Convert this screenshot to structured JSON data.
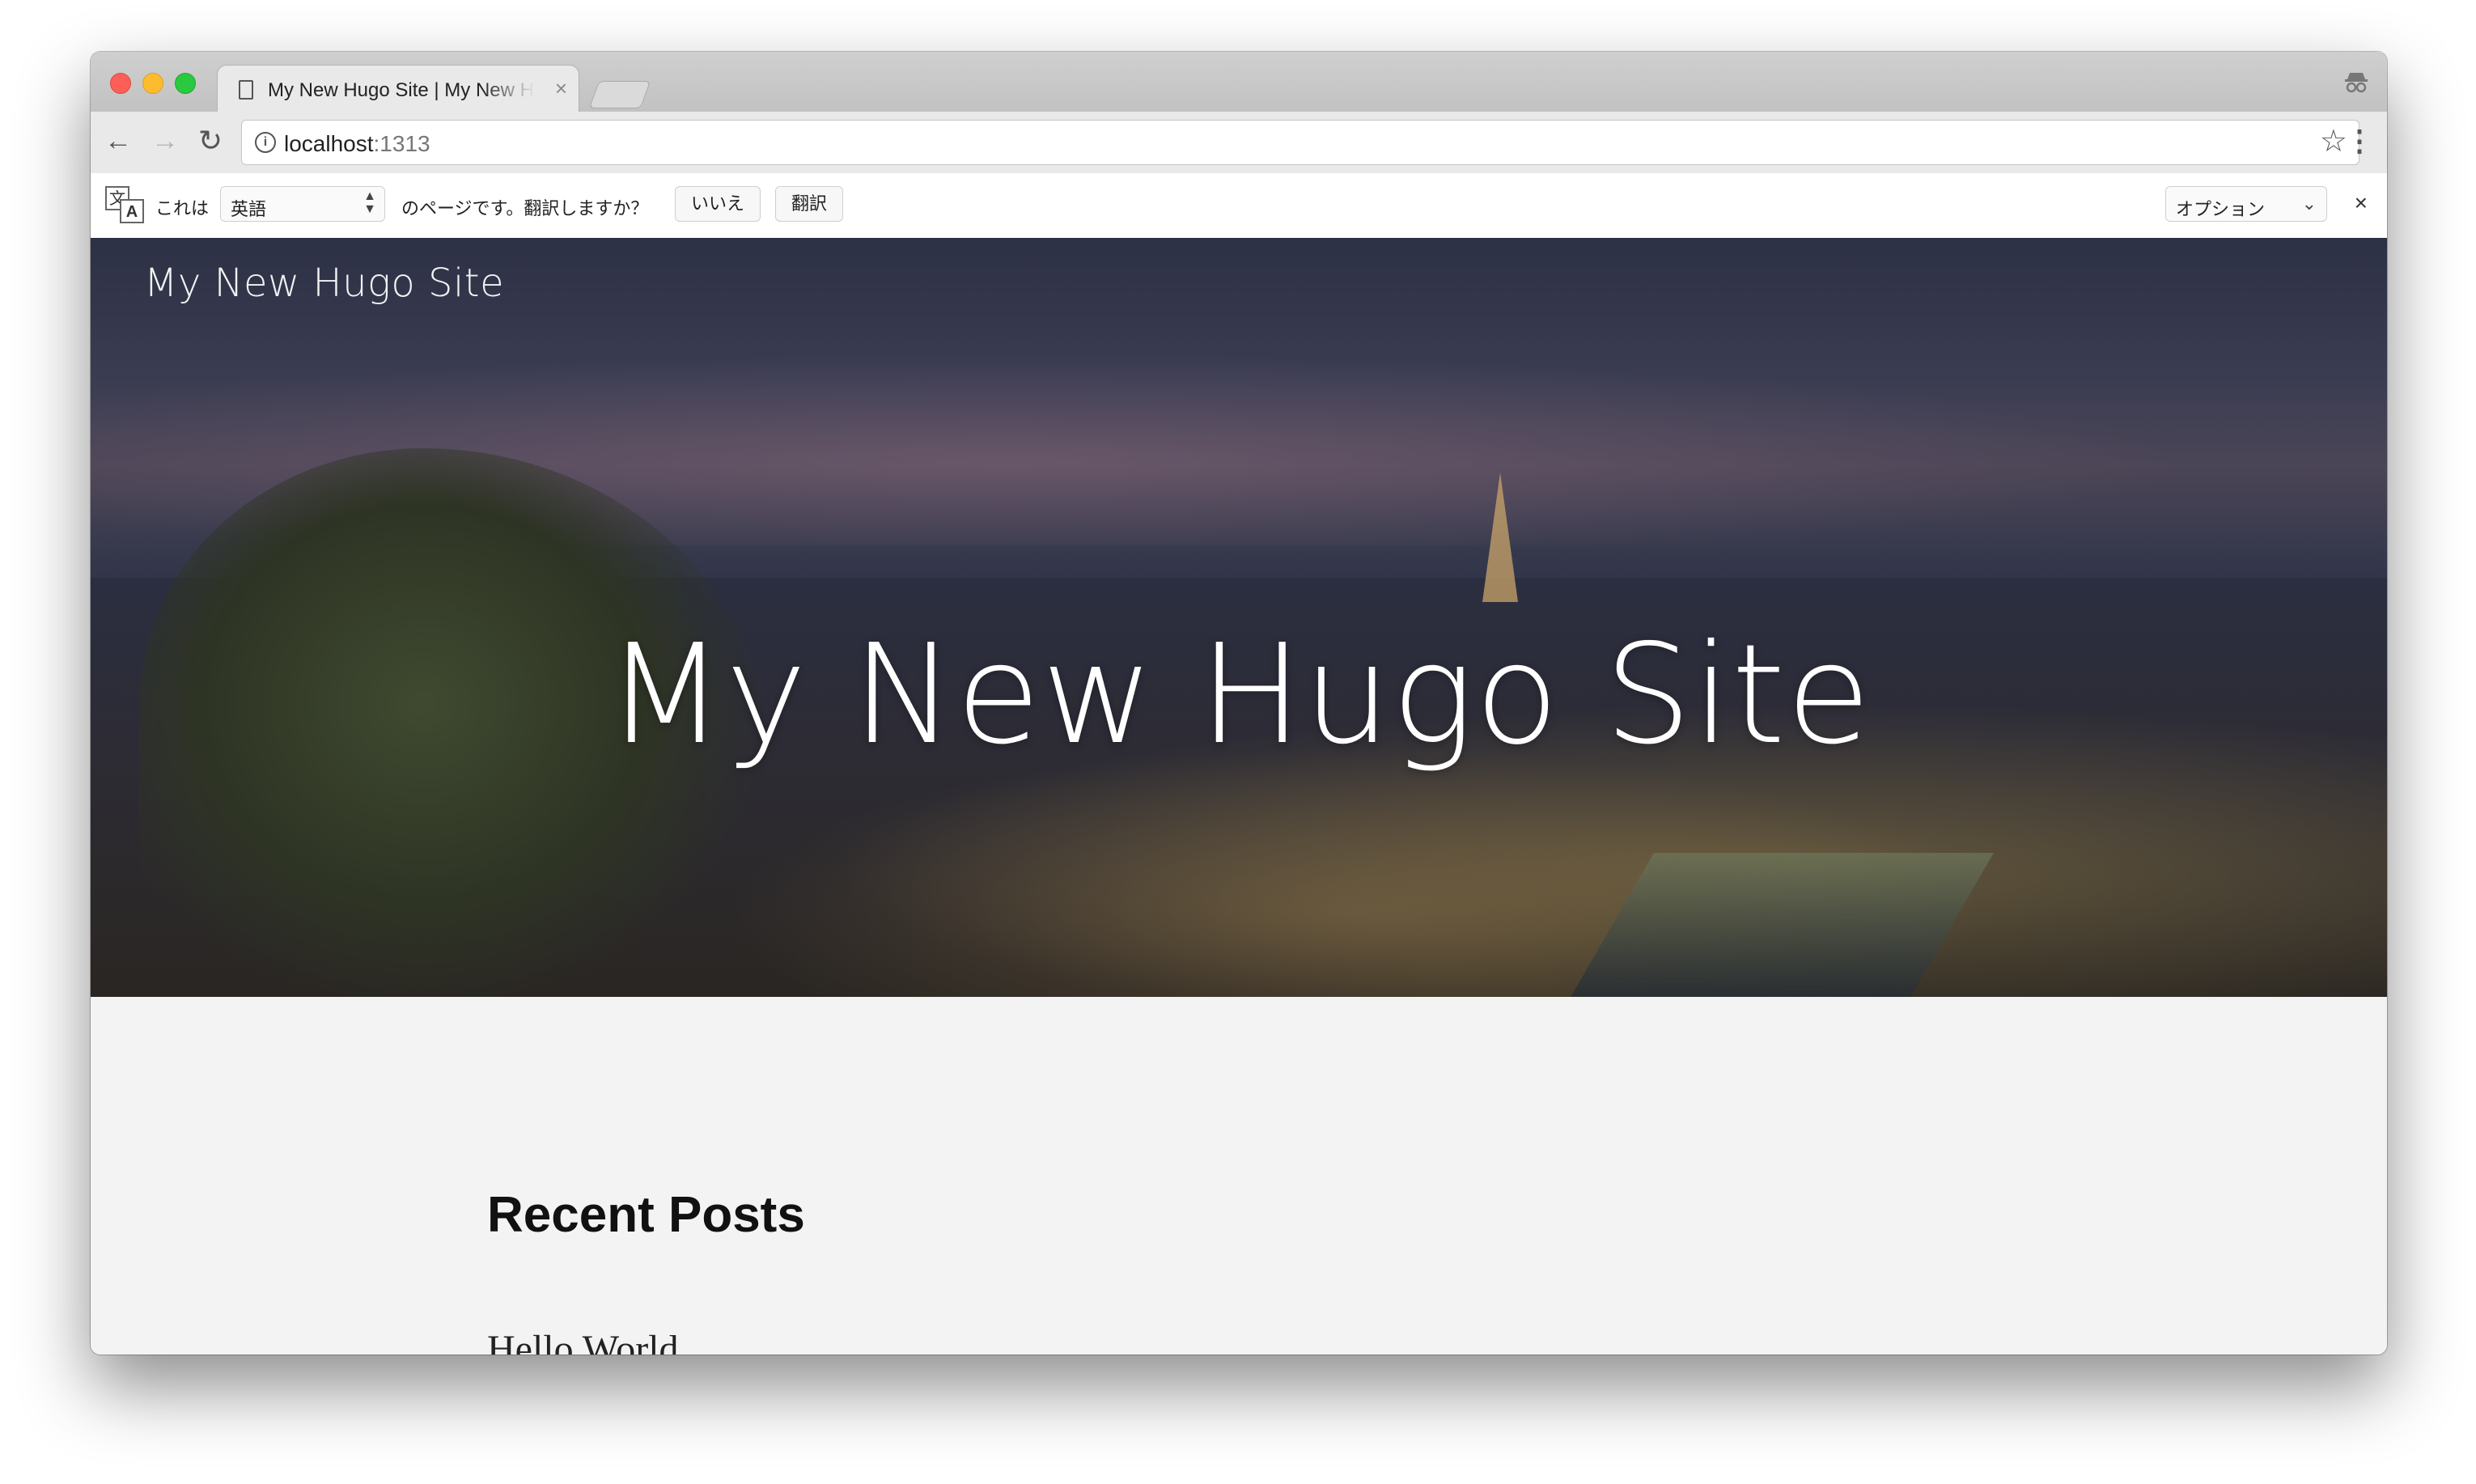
{
  "browser": {
    "tab_title": "My New Hugo Site | My New Hugo Site",
    "tab_close_icon": "×",
    "url_host": "localhost",
    "url_port": ":1313"
  },
  "translate_bar": {
    "prefix": "これは",
    "language": "英語",
    "question": "のページです。翻訳しますか？",
    "no_button": "いいえ",
    "translate_button": "翻訳",
    "options_label": "オプション",
    "close_icon": "×"
  },
  "hero": {
    "brand": "My New Hugo Site",
    "title": "My New Hugo Site"
  },
  "main": {
    "heading": "Recent Posts",
    "posts": [
      {
        "title": "Hello World"
      }
    ]
  }
}
